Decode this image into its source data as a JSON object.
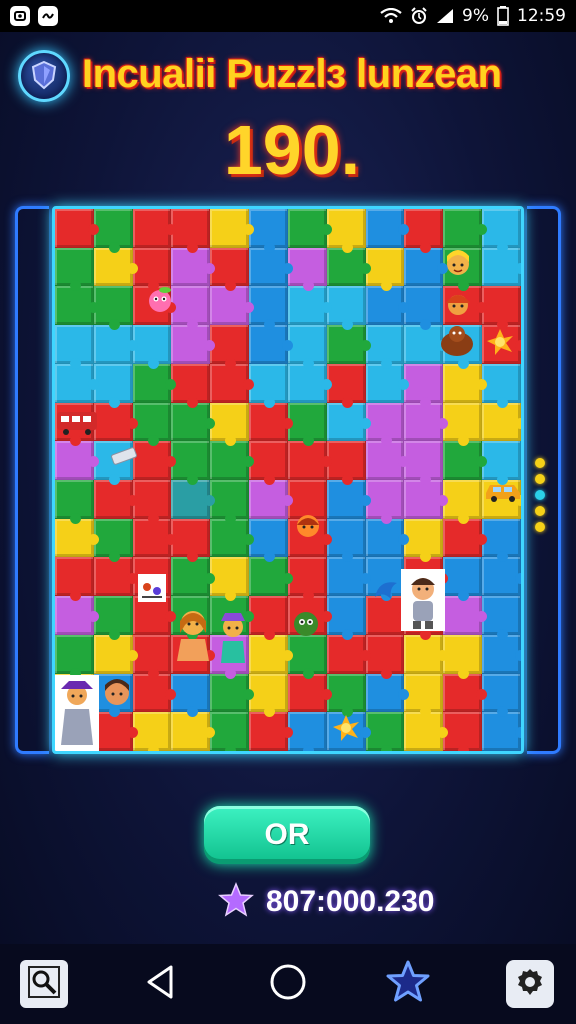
{
  "status_bar": {
    "battery": "9%",
    "time": "12:59"
  },
  "header": {
    "title": "Incualii Puzzlз lunzean",
    "score": "190."
  },
  "board": {
    "columns": 12,
    "rows": 14,
    "colors": {
      "R": "#e52a2a",
      "G": "#21a83c",
      "B": "#1f8fe0",
      "Y": "#f5d018",
      "P": "#c55ee0",
      "C": "#2bb8e8",
      "O": "#ff7a1a",
      "T": "#2a9ea4"
    },
    "layout": [
      "RGRRYBGYBRGC",
      "GYRPRBPGYBGC",
      "GGRPPBCCBBRR",
      "CCCPRBCGCCCR",
      "CCGRRCCRCPYC",
      "RRGGYRGCPPYY",
      "PCRGGRRRPPGC",
      "GRRTGPRBPPYY",
      "YGRRGBRBBYRB",
      "RRRGYGRBBRBB",
      "PGRGGRRBRRPB",
      "GYRRPYGRRYYB",
      "YBRBGYRGBYRB",
      "CRYYGRBBGYRB"
    ],
    "page_dots": [
      "#f5d018",
      "#f5d018",
      "#2bd0e8",
      "#f5d018",
      "#f5d018"
    ]
  },
  "actions": {
    "ok_label": "OR",
    "points_value": "807:000.230"
  },
  "nav": {
    "items": [
      "search",
      "back",
      "home",
      "favorites",
      "settings"
    ]
  }
}
